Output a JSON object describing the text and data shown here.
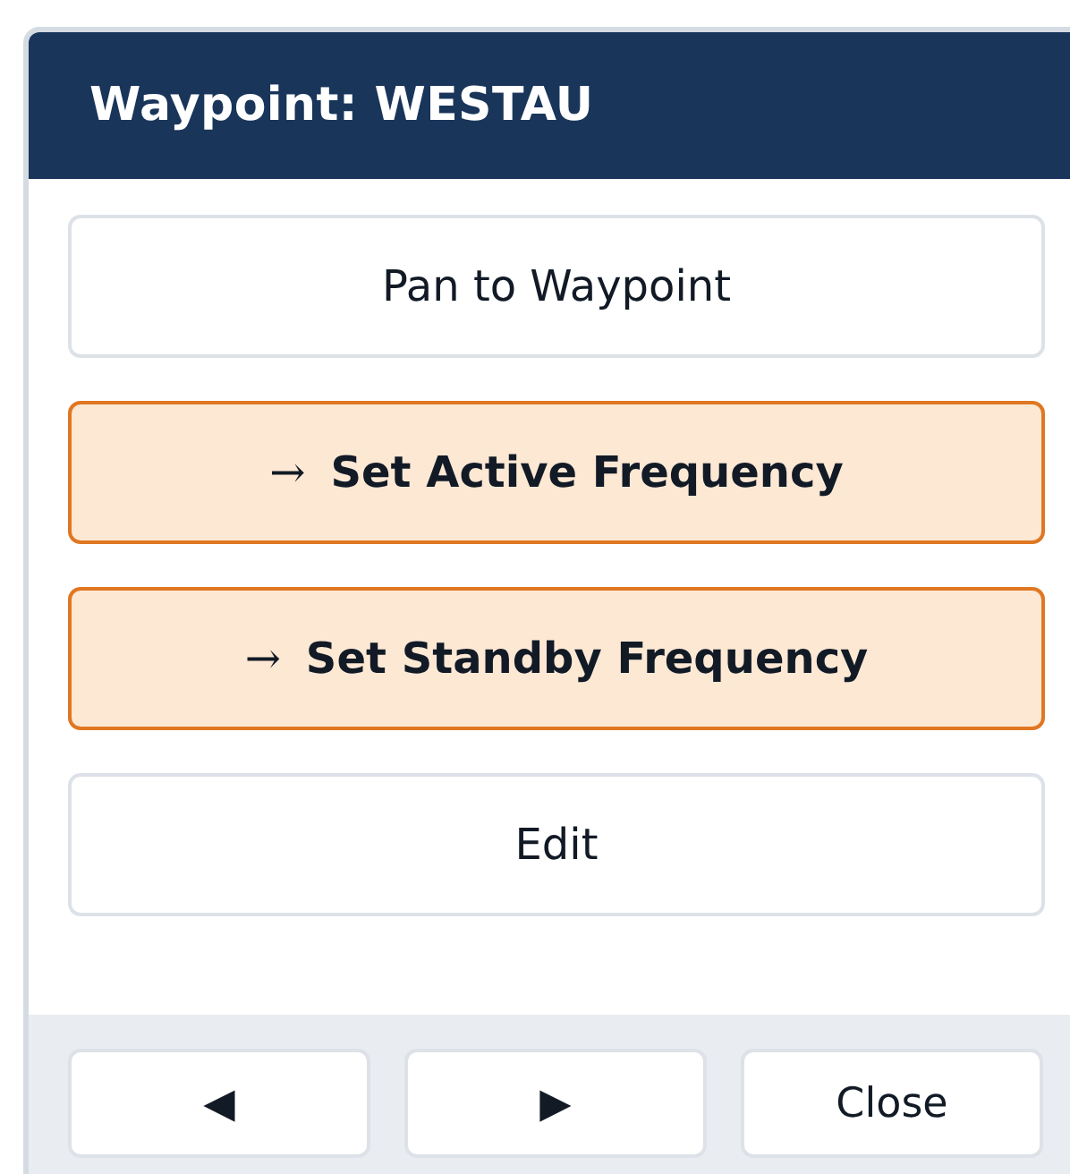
{
  "window": {
    "title": "Waypoint: WESTAU"
  },
  "actions": [
    {
      "kind": "plain",
      "label": "Pan to Waypoint"
    },
    {
      "kind": "accent",
      "prefix": "→",
      "label": "Set Active Frequency"
    },
    {
      "kind": "accent",
      "prefix": "→",
      "label": "Set Standby Frequency"
    },
    {
      "kind": "plain",
      "label": "Edit"
    }
  ],
  "footer": [
    "◀",
    "▶",
    "Close"
  ]
}
